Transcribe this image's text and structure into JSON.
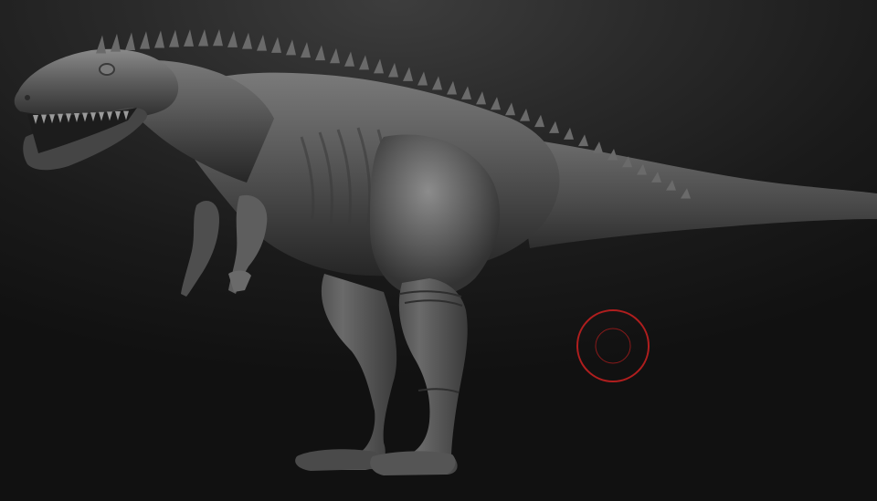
{
  "viewport": {
    "background_top": "#3d3d3d",
    "background_bottom": "#111111"
  },
  "model": {
    "subject": "dinosaur-sculpt",
    "material_color": "#5c5c5c",
    "shadow_color": "#262626",
    "highlight_color": "#9a9a9a"
  },
  "brush": {
    "ring_color": "#b01e1e",
    "inner_ring_color": "#8a1a1a"
  }
}
